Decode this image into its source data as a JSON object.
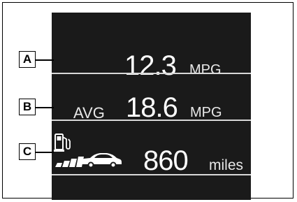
{
  "callouts": {
    "a": "A",
    "b": "B",
    "c": "C"
  },
  "rows": {
    "current_economy": {
      "value": "12.3",
      "unit": "MPG"
    },
    "average_economy": {
      "prefix": "AVG",
      "value": "18.6",
      "unit": "MPG"
    },
    "range": {
      "value": "860",
      "unit": "miles",
      "icons": [
        "fuel-pump-icon",
        "car-icon",
        "range-bars-icon"
      ]
    }
  },
  "colors": {
    "screen_bg": "#1a1a1a",
    "text": "#ffffff",
    "divider": "#d8d8d8"
  }
}
